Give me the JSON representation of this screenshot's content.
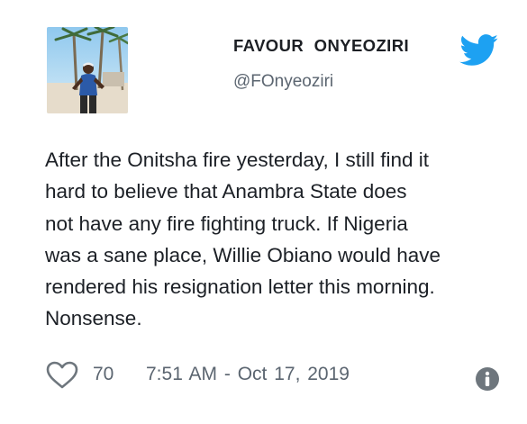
{
  "tweet": {
    "display_name": "FAVOUR  ONYEOZIRI",
    "handle": "@FOnyeoziri",
    "text": "After the Onitsha fire yesterday, I still find it\nhard to believe that Anambra State does\nnot have any fire fighting truck. If Nigeria\nwas a sane place, Willie Obiano would have\nrendered his resignation letter this morning.\nNonsense.",
    "like_count": "70",
    "timestamp": "7:51 AM - Oct 17, 2019"
  },
  "icons": {
    "brand": "twitter-bird-icon",
    "like": "heart-outline-icon",
    "info": "info-circle-icon"
  },
  "colors": {
    "twitter_blue": "#1da1f2",
    "text_primary": "#1c2026",
    "text_secondary": "#5b6570",
    "icon_gray": "#6e767d"
  }
}
